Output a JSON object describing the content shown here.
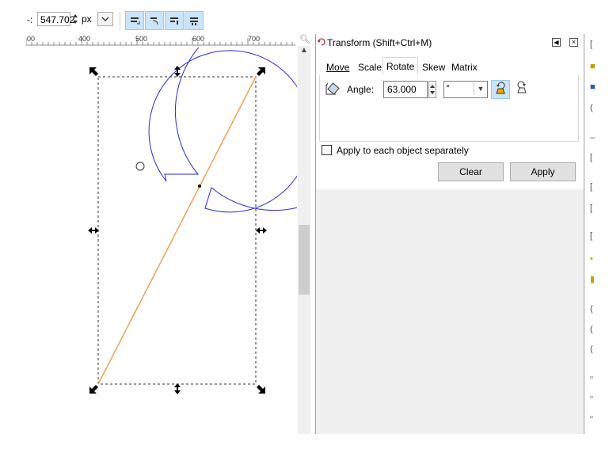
{
  "toolbar": {
    "prefix": "‑:",
    "value": "547.702",
    "unit": "px",
    "buttons": [
      "align-top-icon",
      "align-rotate-icon",
      "align-center-icon",
      "align-bottom-icon"
    ]
  },
  "ruler": {
    "labels": [
      "00",
      "400",
      "500",
      "600",
      "700"
    ]
  },
  "panel": {
    "title": "Transform (Shift+Ctrl+M)",
    "tabs": [
      {
        "label": "Move",
        "active": false
      },
      {
        "label": "Scale",
        "active": false
      },
      {
        "label": "Rotate",
        "active": true
      },
      {
        "label": "Skew",
        "active": false
      },
      {
        "label": "Matrix",
        "active": false
      }
    ],
    "angle_label": "Angle:",
    "angle_value": "63.000",
    "angle_unit": "°",
    "apply_each_label": "Apply to each object separately",
    "apply_each_checked": false,
    "clear_label": "Clear",
    "apply_label": "Apply"
  },
  "colors": {
    "selection_line": "#f0a050",
    "circle_stroke": "#2a2ad8",
    "toggle_active": "#cce4f7"
  }
}
